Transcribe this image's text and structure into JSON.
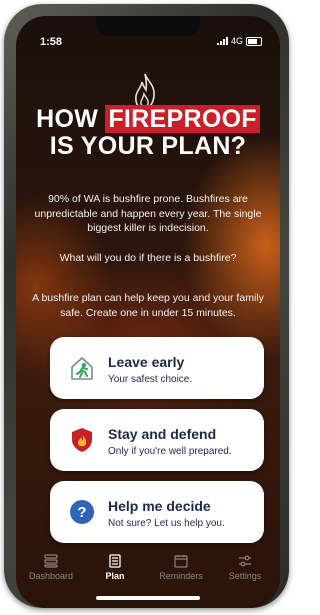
{
  "status": {
    "time": "1:58",
    "network": "4G"
  },
  "headline": {
    "line1_prefix": "HOW ",
    "line1_highlight": "FIREPROOF",
    "line2": "IS YOUR PLAN?"
  },
  "body": {
    "p1": "90% of WA is bushfire prone. Bushfires are unpredictable and happen every year. The single biggest killer is indecision.",
    "p2": "What will you do if there is a bushfire?",
    "p3": "A bushfire plan can help keep you and your family safe. Create one in under 15 minutes."
  },
  "options": [
    {
      "title": "Leave early",
      "subtitle": "Your safest choice.",
      "icon": "house-exit-icon"
    },
    {
      "title": "Stay and defend",
      "subtitle": "Only if you're well prepared.",
      "icon": "shield-flame-icon"
    },
    {
      "title": "Help me decide",
      "subtitle": "Not sure? Let us help you.",
      "icon": "question-icon"
    }
  ],
  "tabs": [
    {
      "label": "Dashboard",
      "icon": "dashboard-icon"
    },
    {
      "label": "Plan",
      "icon": "plan-icon"
    },
    {
      "label": "Reminders",
      "icon": "calendar-icon"
    },
    {
      "label": "Settings",
      "icon": "sliders-icon"
    }
  ],
  "active_tab": "Plan",
  "colors": {
    "accent_red": "#c8202a",
    "card_text": "#1e2a4a",
    "help_blue": "#2f64b7",
    "exit_green": "#2fa84f"
  }
}
